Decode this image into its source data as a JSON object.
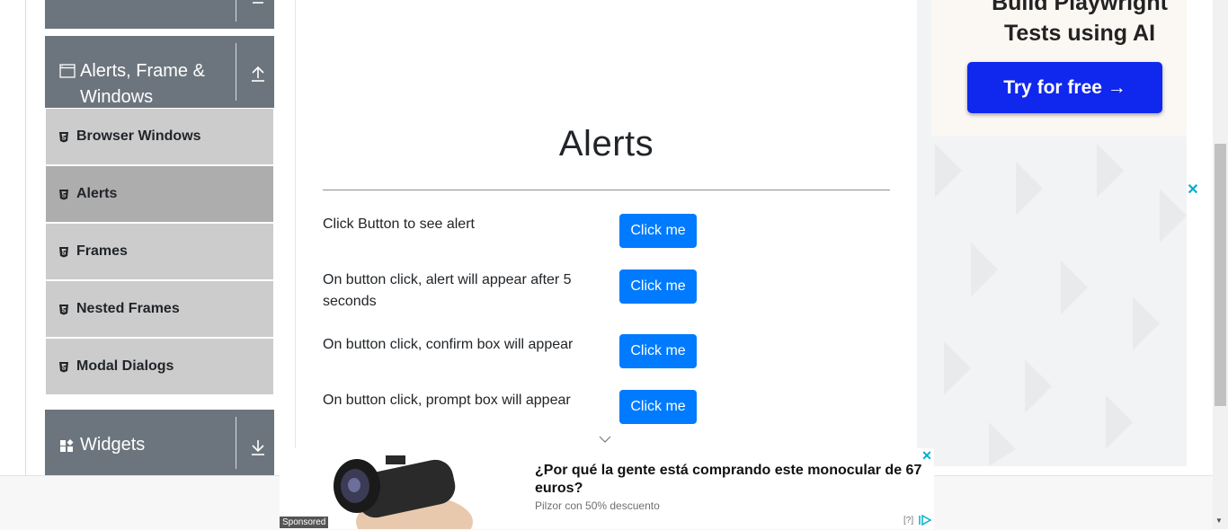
{
  "sidebar": {
    "group_alerts": {
      "title": "Alerts, Frame & Windows"
    },
    "items": [
      {
        "label": "Browser Windows"
      },
      {
        "label": "Alerts"
      },
      {
        "label": "Frames"
      },
      {
        "label": "Nested Frames"
      },
      {
        "label": "Modal Dialogs"
      }
    ],
    "group_widgets": {
      "title": "Widgets"
    }
  },
  "main": {
    "title": "Alerts",
    "rows": [
      {
        "label": "Click Button to see alert",
        "button": "Click me"
      },
      {
        "label": "On button click, alert will appear after 5 seconds",
        "button": "Click me"
      },
      {
        "label": "On button click, confirm box will appear",
        "button": "Click me"
      },
      {
        "label": "On button click, prompt box will appear",
        "button": "Click me"
      }
    ]
  },
  "right_ad": {
    "title_line1": "Build Playwright",
    "title_line2": "Tests using AI",
    "cta": "Try for free →"
  },
  "bottom_ad": {
    "headline": "¿Por qué la gente está comprando este monocular de 67 euros?",
    "subtext": "Pilzor con 50% descuento",
    "sponsored": "Sponsored",
    "info": "[?]"
  },
  "colors": {
    "sidebar_header": "#6c757d",
    "sidebar_item": "#cccccc",
    "sidebar_item_active": "#adadad",
    "primary": "#007bff",
    "ad_cta": "#1027ee"
  }
}
